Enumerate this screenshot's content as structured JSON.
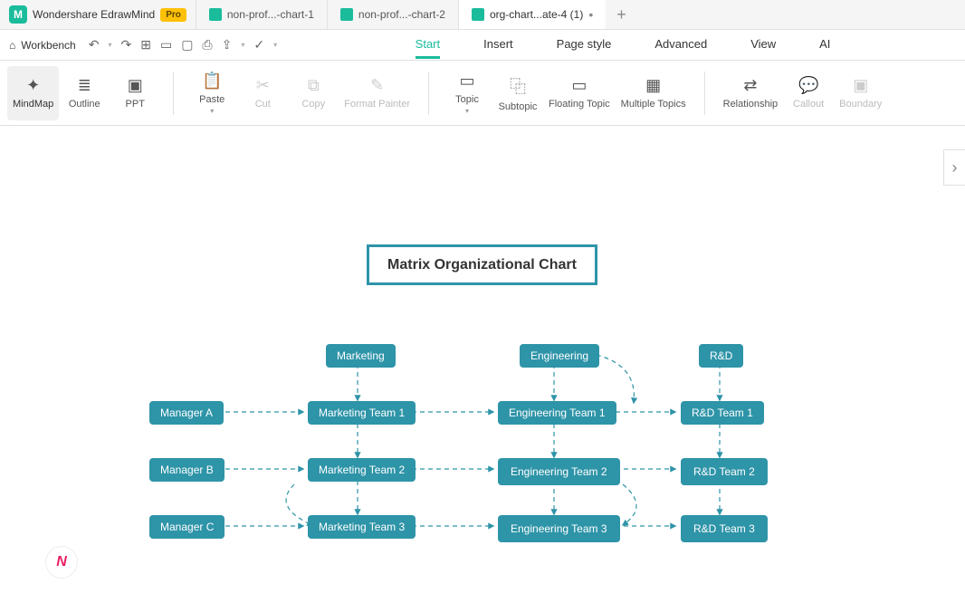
{
  "app": {
    "title": "Wondershare EdrawMind",
    "badge": "Pro"
  },
  "tabs": [
    {
      "label": "non-prof...-chart-1",
      "active": false
    },
    {
      "label": "non-prof...-chart-2",
      "active": false
    },
    {
      "label": "org-chart...ate-4 (1)",
      "active": true
    }
  ],
  "workbench": "Workbench",
  "menus": {
    "start": "Start",
    "insert": "Insert",
    "page_style": "Page style",
    "advanced": "Advanced",
    "view": "View",
    "ai": "AI"
  },
  "ribbon": {
    "mindmap": "MindMap",
    "outline": "Outline",
    "ppt": "PPT",
    "paste": "Paste",
    "cut": "Cut",
    "copy": "Copy",
    "format_painter": "Format Painter",
    "topic": "Topic",
    "subtopic": "Subtopic",
    "floating_topic": "Floating Topic",
    "multiple_topics": "Multiple Topics",
    "relationship": "Relationship",
    "callout": "Callout",
    "boundary": "Boundary"
  },
  "diagram": {
    "title": "Matrix Organizational Chart",
    "headers": {
      "marketing": "Marketing",
      "engineering": "Engineering",
      "rd": "R&D"
    },
    "managers": {
      "a": "Manager A",
      "b": "Manager B",
      "c": "Manager C"
    },
    "teams": {
      "mkt1": "Marketing Team 1",
      "mkt2": "Marketing Team 2",
      "mkt3": "Marketing Team 3",
      "eng1": "Engineering Team 1",
      "eng2": "Engineering Team 2",
      "eng3": "Engineering Team 3",
      "rd1": "R&D Team 1",
      "rd2": "R&D Team 2",
      "rd3": "R&D Team 3"
    }
  }
}
